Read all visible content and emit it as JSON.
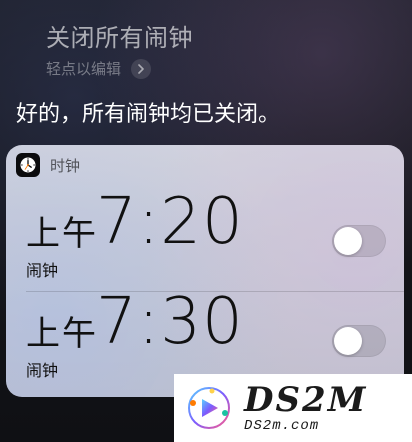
{
  "siri": {
    "query": "关闭所有闹钟",
    "edit_hint": "轻点以编辑",
    "edit_hint_icon": "chevron-right-icon",
    "response": "好的，所有闹钟均已关闭。"
  },
  "card": {
    "app_name": "时钟",
    "app_icon": "clock-icon",
    "alarms": [
      {
        "period": "上午",
        "time": "7:20",
        "label": "闹钟",
        "enabled": false
      },
      {
        "period": "上午",
        "time": "7:30",
        "label": "闹钟",
        "enabled": false
      }
    ]
  },
  "watermark": {
    "brand": "DS2M",
    "domain": "DS2m.com"
  },
  "colors": {
    "background": "#16171c",
    "card_background": "#d6d7e3",
    "toggle_off": "#e6e6ea",
    "toggle_knob": "#ffffff",
    "watermark_background": "#ffffff"
  }
}
